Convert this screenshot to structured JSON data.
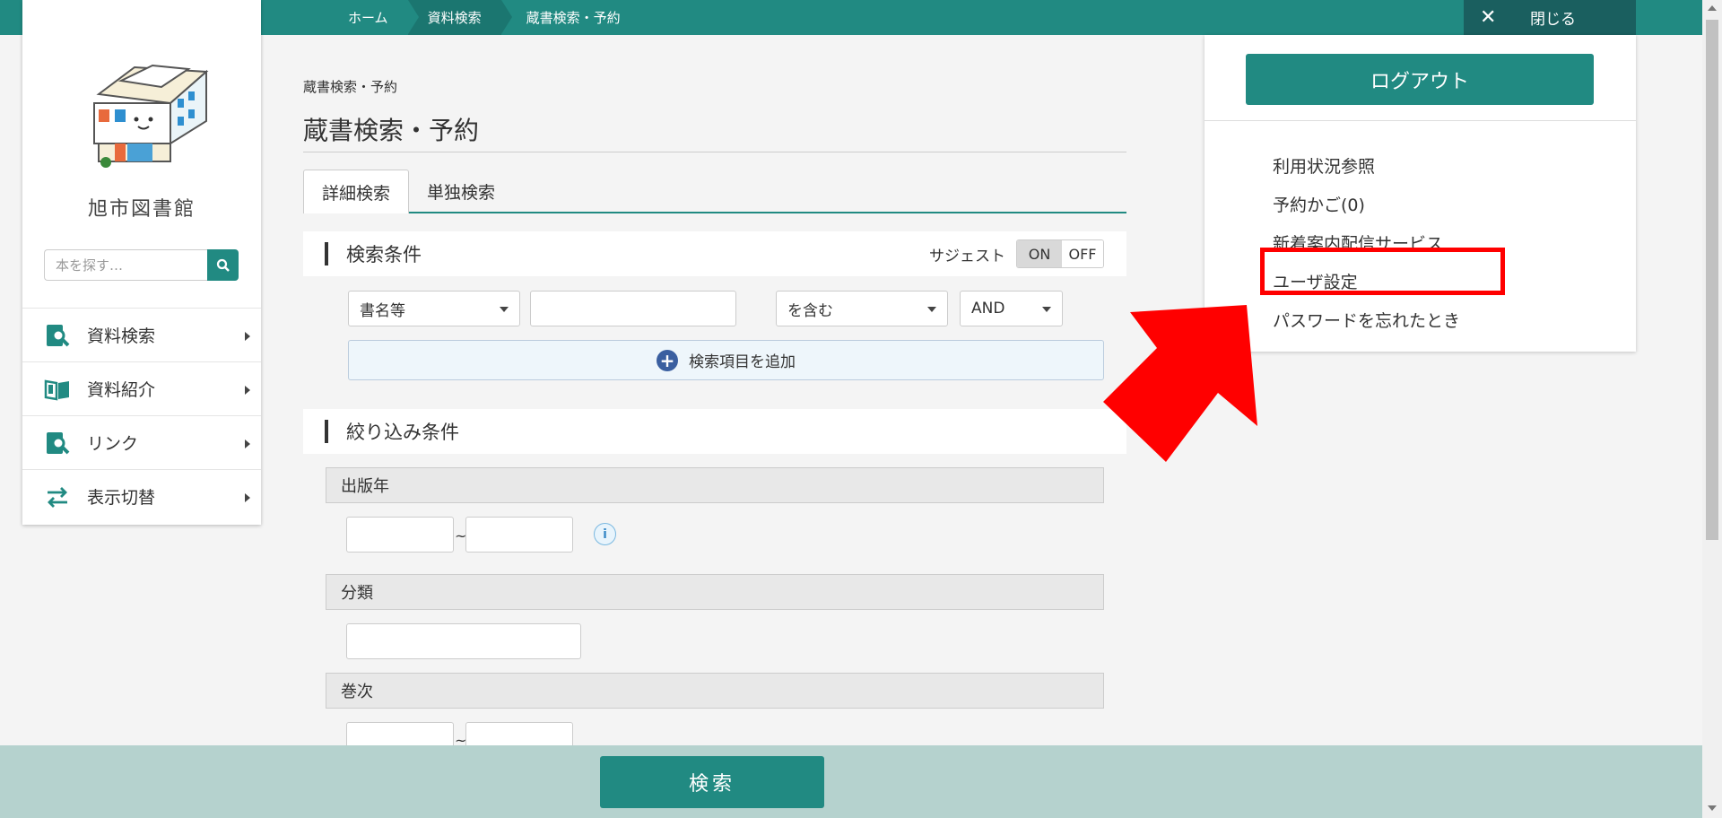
{
  "breadcrumb": [
    "ホーム",
    "資料検索",
    "蔵書検索・予約"
  ],
  "close_label": "閉じる",
  "sidebar": {
    "library_name": "旭市図書館",
    "search_placeholder": "本を探す…",
    "items": [
      {
        "label": "資料検索",
        "icon": "book-search-icon"
      },
      {
        "label": "資料紹介",
        "icon": "open-book-icon"
      },
      {
        "label": "リンク",
        "icon": "link-search-icon"
      },
      {
        "label": "表示切替",
        "icon": "swap-arrows-icon"
      }
    ]
  },
  "main": {
    "small_breadcrumb": "蔵書検索・予約",
    "title": "蔵書検索・予約",
    "tabs": [
      "詳細検索",
      "単独検索"
    ],
    "search_conditions": {
      "heading": "検索条件",
      "suggest_label": "サジェスト",
      "toggle_on": "ON",
      "toggle_off": "OFF",
      "field_select": "書名等",
      "match_select": "を含む",
      "logic_select": "AND",
      "add_item": "検索項目を追加"
    },
    "filter_conditions": {
      "heading": "絞り込み条件",
      "publish_year": "出版年",
      "classification": "分類",
      "volume": "巻次",
      "tilde": "~"
    },
    "search_button": "検索"
  },
  "user_panel": {
    "logout": "ログアウト",
    "items": [
      "利用状況参照",
      "予約かご(0)",
      "新着案内配信サービス",
      "ユーザ設定",
      "パスワードを忘れたとき"
    ],
    "highlighted_item": "ユーザ設定"
  },
  "colors": {
    "brand": "#218a82",
    "highlight": "#ff0000",
    "bottom_bar": "#b5d2ce"
  }
}
